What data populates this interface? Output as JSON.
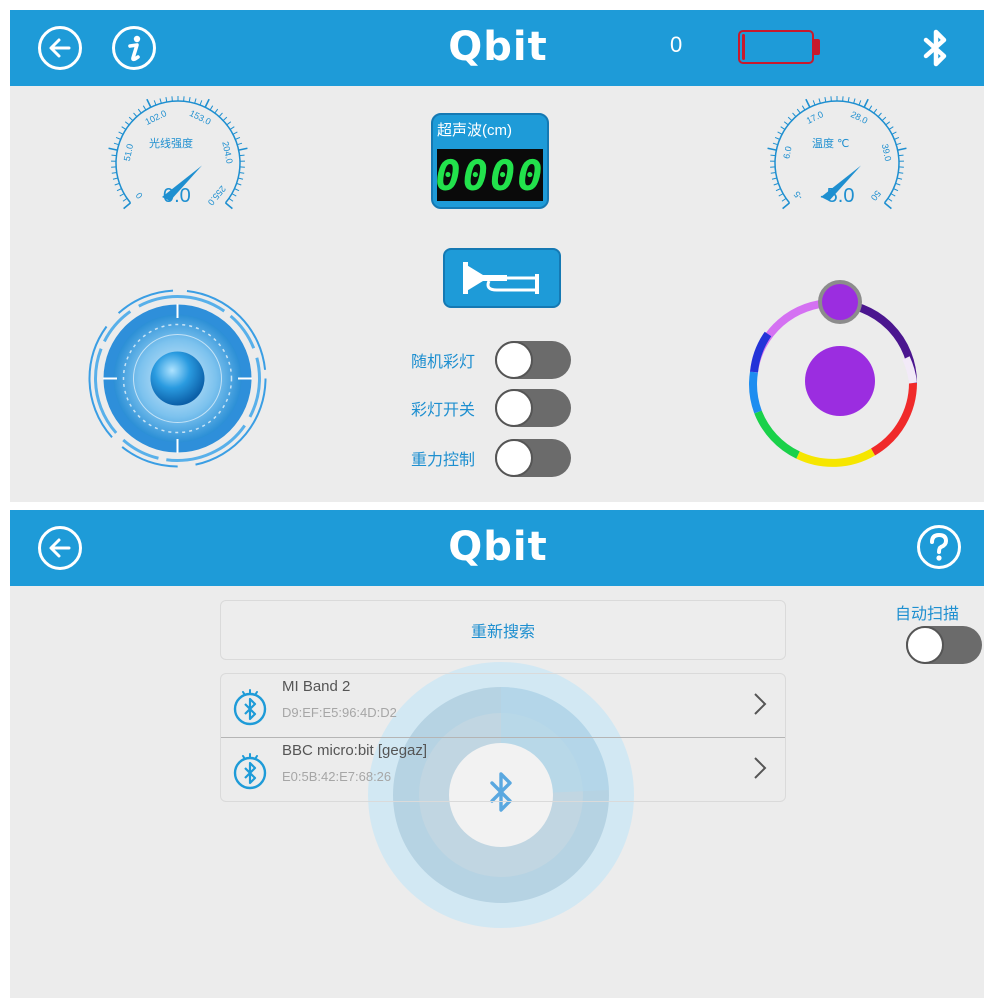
{
  "control_screen": {
    "title": "Qbit",
    "battery_count": "0",
    "battery_level": 0.05,
    "light_gauge": {
      "label": "光线强度",
      "value": "0.0",
      "ticks": [
        "0",
        "51.0",
        "102.0",
        "153.0",
        "204.0",
        "255.0"
      ]
    },
    "temp_gauge": {
      "label": "温度 ℃",
      "value": "-5.0",
      "ticks": [
        "-5",
        "6.0",
        "17.0",
        "28.0",
        "39.0",
        "50"
      ]
    },
    "ultrasonic": {
      "label": "超声波(cm)",
      "value": "0000"
    },
    "toggles": [
      {
        "label": "随机彩灯",
        "on": false
      },
      {
        "label": "彩灯开关",
        "on": false
      },
      {
        "label": "重力控制",
        "on": false
      }
    ],
    "color_picker": {
      "selected_color": "#9b2de0"
    },
    "colors": {
      "accent": "#1e9bd8",
      "battery": "#c8192c",
      "digits": "#22e24c"
    }
  },
  "scan_screen": {
    "title": "Qbit",
    "rescan_label": "重新搜索",
    "auto_scan": {
      "label": "自动扫描",
      "on": false
    },
    "devices": [
      {
        "name": "MI Band 2",
        "address": "D9:EF:E5:96:4D:D2"
      },
      {
        "name": "BBC micro:bit [gegaz]",
        "address": "E0:5B:42:E7:68:26"
      }
    ]
  }
}
